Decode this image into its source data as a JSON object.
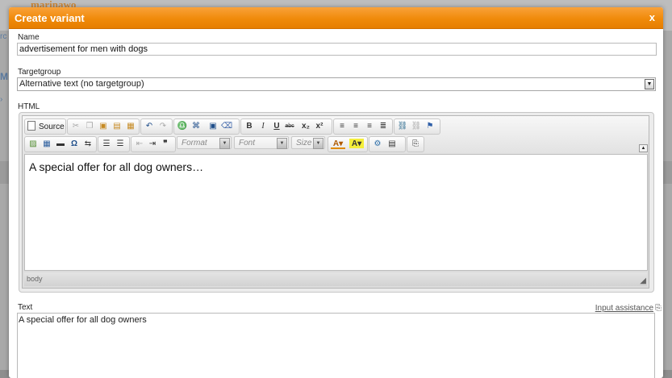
{
  "background": {
    "logo": "marinawo",
    "left_fragments": [
      "rc",
      "M",
      "›"
    ]
  },
  "dialog": {
    "title": "Create variant",
    "close_label": "x",
    "name_label": "Name",
    "name_value": "advertisement for men with dogs",
    "targetgroup_label": "Targetgroup",
    "targetgroup_value": "Alternative text (no targetgroup)",
    "html_label": "HTML",
    "editor": {
      "source_label": "Source",
      "format_placeholder": "Format",
      "font_placeholder": "Font",
      "size_placeholder": "Size",
      "content": "A special offer for all dog owners…",
      "path": "body"
    },
    "text_label": "Text",
    "input_assistance": "Input assistance",
    "text_value": "A special offer for all dog owners"
  },
  "colors": {
    "accent": "#f08a0a",
    "title_text": "#ffffff"
  }
}
